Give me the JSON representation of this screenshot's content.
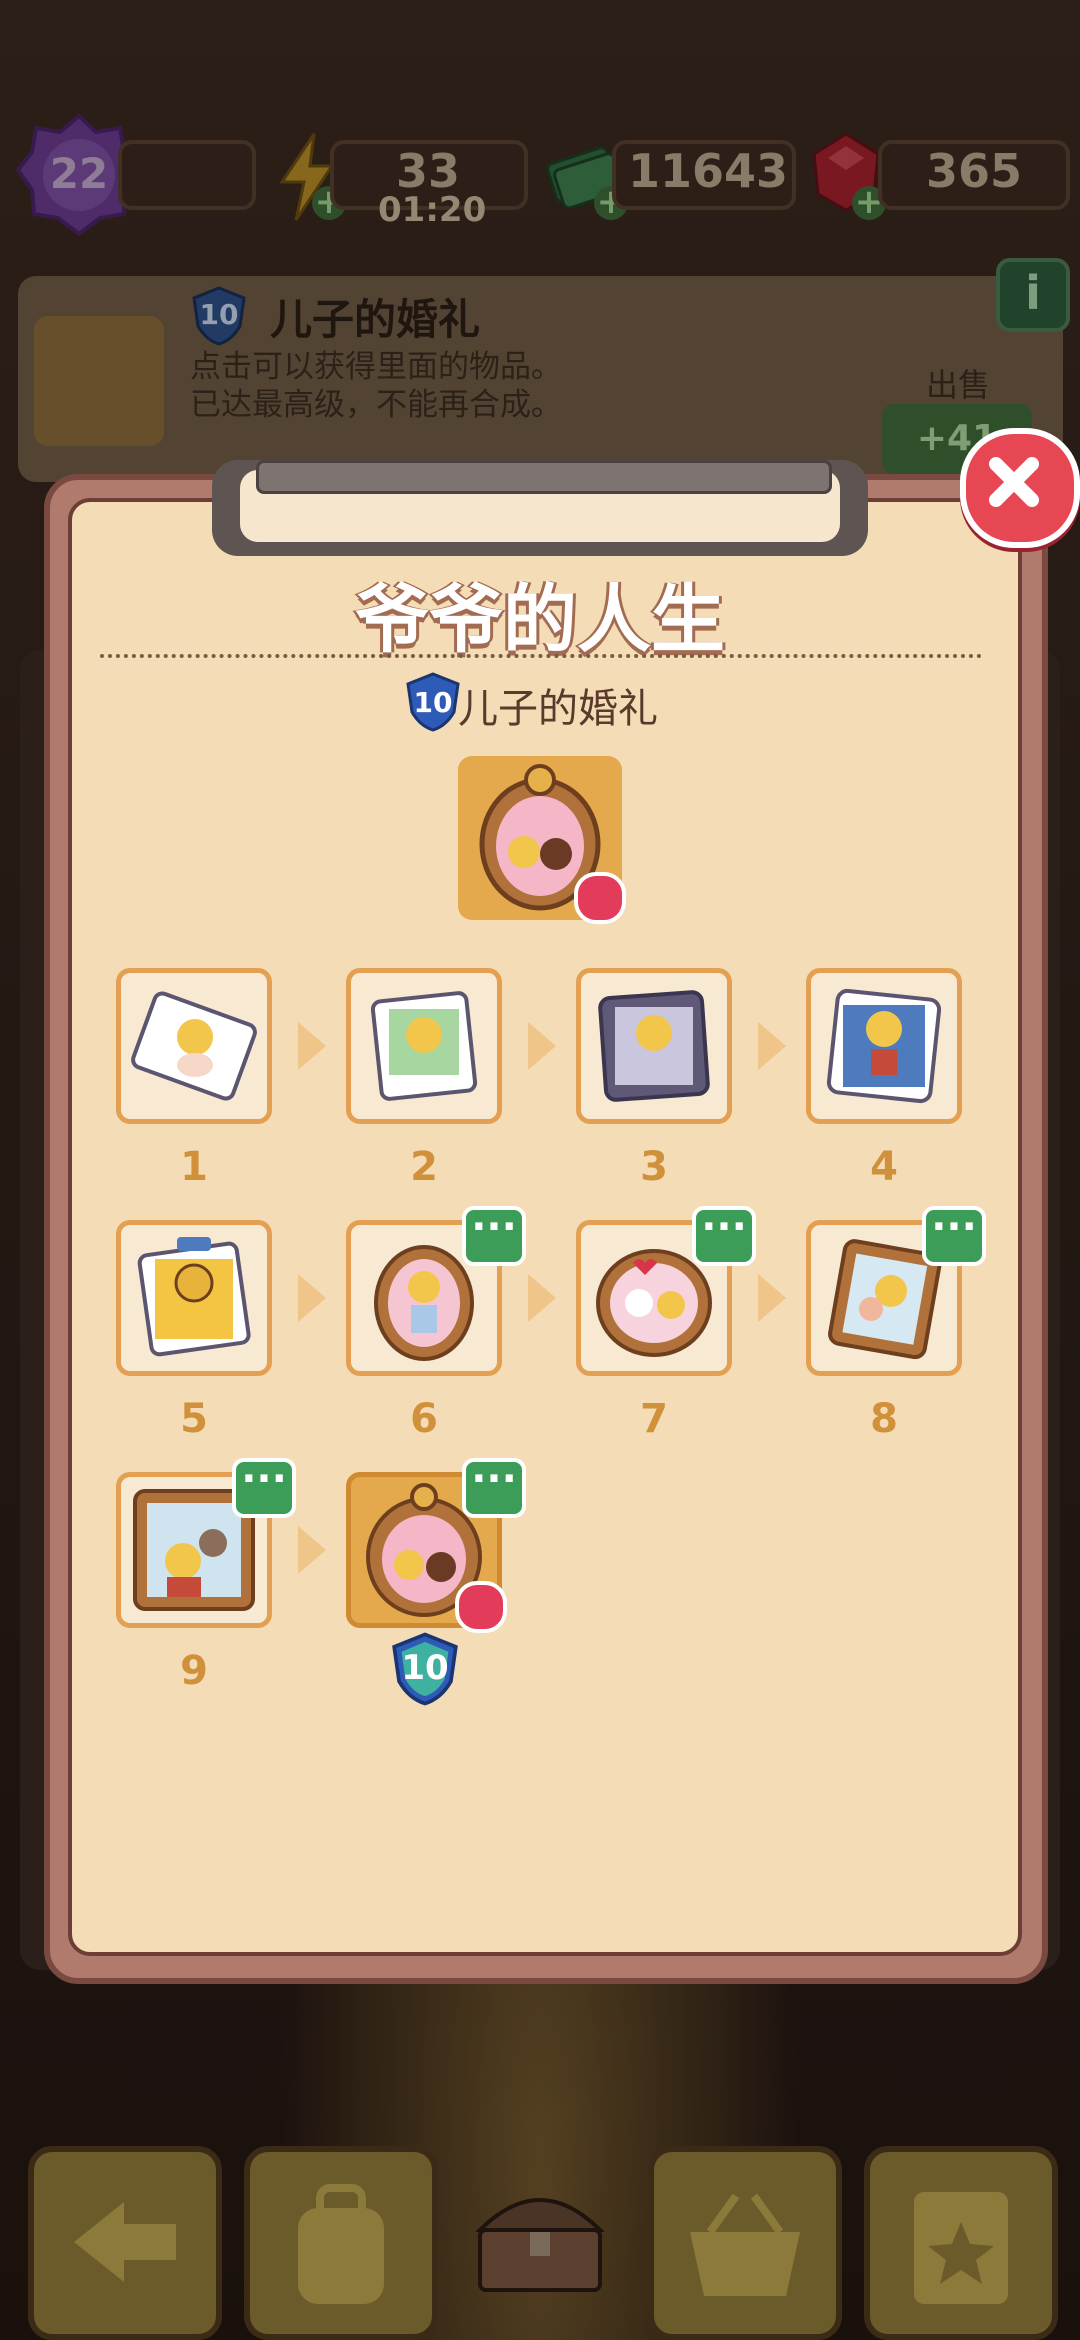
{
  "top_bar": {
    "level": "22",
    "energy": "33",
    "energy_timer": "01:20",
    "cash": "11643",
    "gems": "365"
  },
  "info_card": {
    "level": "10",
    "title": "儿子的婚礼",
    "desc_line1": "点击可以获得里面的物品。",
    "desc_line2": "已达最高级，不能再合成。",
    "sell_label": "出售",
    "sell_value": "+41",
    "info_icon": "i"
  },
  "panel": {
    "title": "爷爷的人生",
    "subtitle": "儿子的婚礼",
    "subtitle_level": "10",
    "close_icon": "close-icon",
    "items": [
      {
        "num": "1"
      },
      {
        "num": "2"
      },
      {
        "num": "3"
      },
      {
        "num": "4"
      },
      {
        "num": "5"
      },
      {
        "num": "6"
      },
      {
        "num": "7"
      },
      {
        "num": "8"
      },
      {
        "num": "9"
      },
      {
        "num": "10"
      }
    ]
  },
  "colors": {
    "panel_bg": "#f3dcb6",
    "tile_border": "#e3a052",
    "number": "#d1903a",
    "close": "#e74653",
    "dots_badge": "#3b9d57"
  }
}
